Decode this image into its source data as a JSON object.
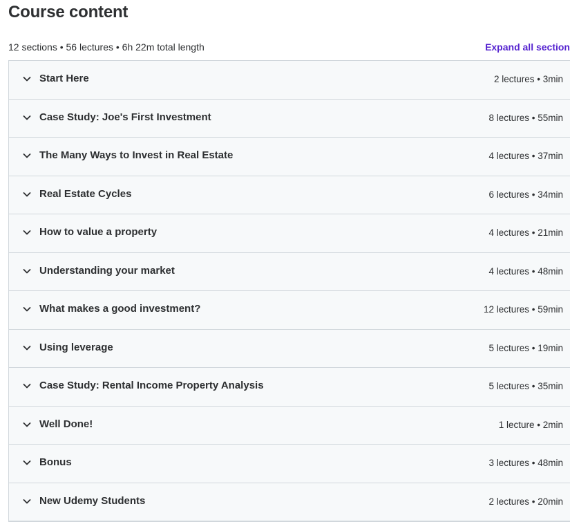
{
  "header": {
    "title": "Course content",
    "summary": "12 sections • 56 lectures • 6h 22m total length",
    "expand_all_label": "Expand all section"
  },
  "colors": {
    "accent": "#5624d0",
    "row_background": "#f7f9fa",
    "border": "#d1d7dc",
    "text": "#2d2f31"
  },
  "sections": [
    {
      "title": "Start Here",
      "meta": "2 lectures • 3min",
      "icon": "chevron-down-icon"
    },
    {
      "title": "Case Study: Joe's First Investment",
      "meta": "8 lectures • 55min",
      "icon": "chevron-down-icon"
    },
    {
      "title": "The Many Ways to Invest in Real Estate",
      "meta": "4 lectures • 37min",
      "icon": "chevron-down-icon"
    },
    {
      "title": "Real Estate Cycles",
      "meta": "6 lectures • 34min",
      "icon": "chevron-down-icon"
    },
    {
      "title": "How to value a property",
      "meta": "4 lectures • 21min",
      "icon": "chevron-down-icon"
    },
    {
      "title": "Understanding your market",
      "meta": "4 lectures • 48min",
      "icon": "chevron-down-icon"
    },
    {
      "title": "What makes a good investment?",
      "meta": "12 lectures • 59min",
      "icon": "chevron-down-icon"
    },
    {
      "title": "Using leverage",
      "meta": "5 lectures • 19min",
      "icon": "chevron-down-icon"
    },
    {
      "title": "Case Study: Rental Income Property Analysis",
      "meta": "5 lectures • 35min",
      "icon": "chevron-down-icon"
    },
    {
      "title": "Well Done!",
      "meta": "1 lecture • 2min",
      "icon": "chevron-down-icon"
    },
    {
      "title": "Bonus",
      "meta": "3 lectures • 48min",
      "icon": "chevron-down-icon"
    },
    {
      "title": "New Udemy Students",
      "meta": "2 lectures • 20min",
      "icon": "chevron-down-icon"
    }
  ]
}
